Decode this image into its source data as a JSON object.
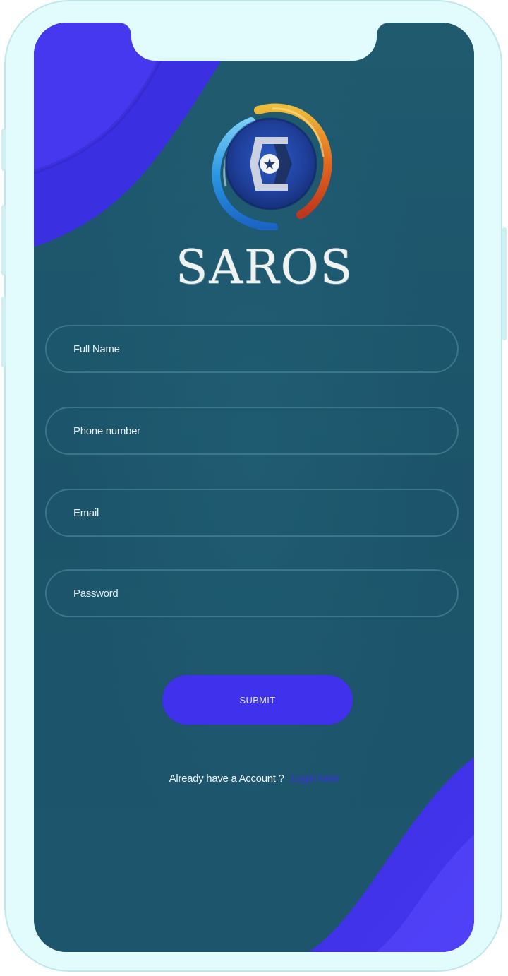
{
  "app": {
    "brand_title": "SAROS",
    "logo_icon": "saros-dragon-emblem-icon"
  },
  "form": {
    "full_name": {
      "placeholder": "Full Name",
      "value": ""
    },
    "phone": {
      "placeholder": "Phone number",
      "value": ""
    },
    "email": {
      "placeholder": "Email",
      "value": ""
    },
    "password": {
      "placeholder": "Password",
      "value": ""
    },
    "submit_label": "SUBMIT"
  },
  "footer": {
    "prompt_text": "Already have a Account ?",
    "login_link_text": "Login here"
  },
  "colors": {
    "screen_background": "#1e566b",
    "accent_wave": "#3f31ec",
    "button": "#3f31ec",
    "link": "#3b2fe6",
    "frame": "#e2fcfd"
  }
}
